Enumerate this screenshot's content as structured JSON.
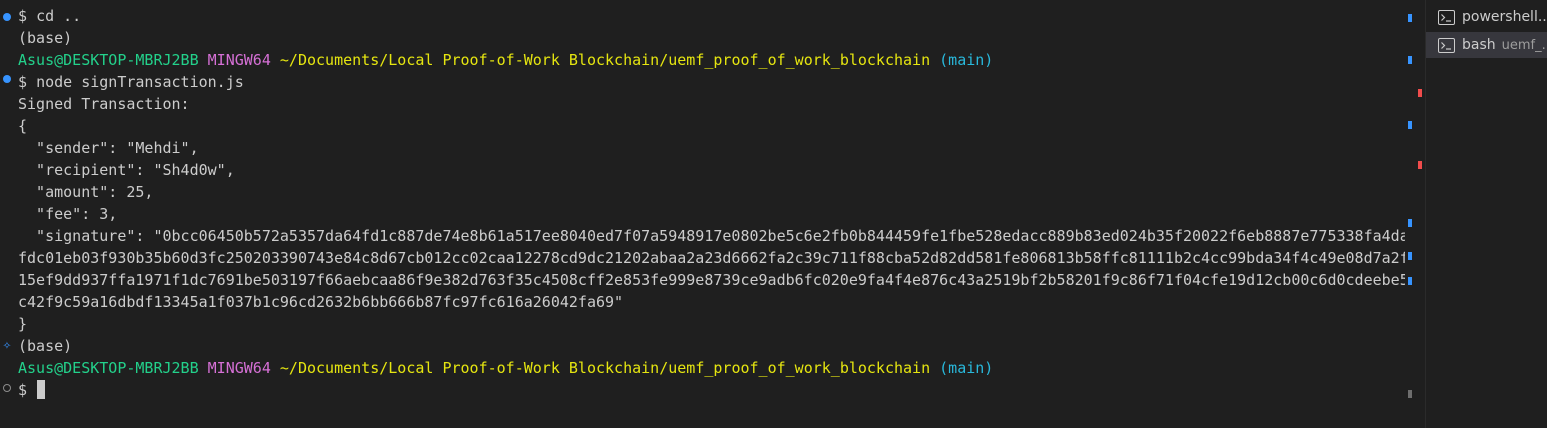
{
  "colors": {
    "background": "#1f1f1f",
    "text": "#cccccc",
    "user_host": "#23d18b",
    "shell": "#d670d6",
    "path": "#e5e510",
    "branch": "#29b8db",
    "decoration_success": "#3794ff",
    "overview_error": "#f14c4c"
  },
  "terminal": {
    "cmd1_prompt": "$ ",
    "cmd1_text": "cd ..",
    "env1": "(base)",
    "prompt1": {
      "user_host": "Asus@DESKTOP-MBRJ2BB",
      "shell": "MINGW64",
      "path": "~/Documents/Local Proof-of-Work Blockchain/uemf_proof_of_work_blockchain",
      "branch": "(main)"
    },
    "cmd2_prompt": "$ ",
    "cmd2_text": "node signTransaction.js",
    "output": {
      "heading": "Signed Transaction:",
      "open_brace": "{",
      "sender_line": "  \"sender\": \"Mehdi\",",
      "recipient_line": "  \"recipient\": \"Sh4d0w\",",
      "amount_line": "  \"amount\": 25,",
      "fee_line": "  \"fee\": 3,",
      "signature_line1": "  \"signature\": \"0bcc06450b572a5357da64fd1c887de74e8b61a517ee8040ed7f07a5948917e0802be5c6e2fb0b844459fe1fbe528edacc889b83ed024b35f20022f6eb8887e775338fa4da",
      "signature_line2": "fdc01eb03f930b35b60d3fc250203390743e84c8d67cb012cc02caa12278cd9dc21202abaa2a23d6662fa2c39c711f88cba52d82dd581fe806813b58ffc81111b2c4cc99bda34f4c49e08d7a2f",
      "signature_line3": "15ef9dd937ffa1971f1dc7691be503197f66aebcaa86f9e382d763f35c4508cff2e853fe999e8739ce9adb6fc020e9fa4f4e876c43a2519bf2b58201f9c86f71f04cfe19d12cb00c6d0cdeebe5",
      "signature_line4": "c42f9c59a16dbdf13345a1f037b1c96cd2632b6bb666b87fc97fc616a26042fa69\"",
      "close_brace": "}"
    },
    "env2": "(base)",
    "prompt2": {
      "user_host": "Asus@DESKTOP-MBRJ2BB",
      "shell": "MINGW64",
      "path": "~/Documents/Local Proof-of-Work Blockchain/uemf_proof_of_work_blockchain",
      "branch": "(main)"
    },
    "cmd3_prompt": "$ "
  },
  "sidebar": {
    "tabs": [
      {
        "label": "powershell...",
        "description": "",
        "icon": "terminal-icon",
        "active": false
      },
      {
        "label": "bash",
        "description": "uemf_...",
        "icon": "terminal-icon",
        "active": true
      }
    ]
  }
}
